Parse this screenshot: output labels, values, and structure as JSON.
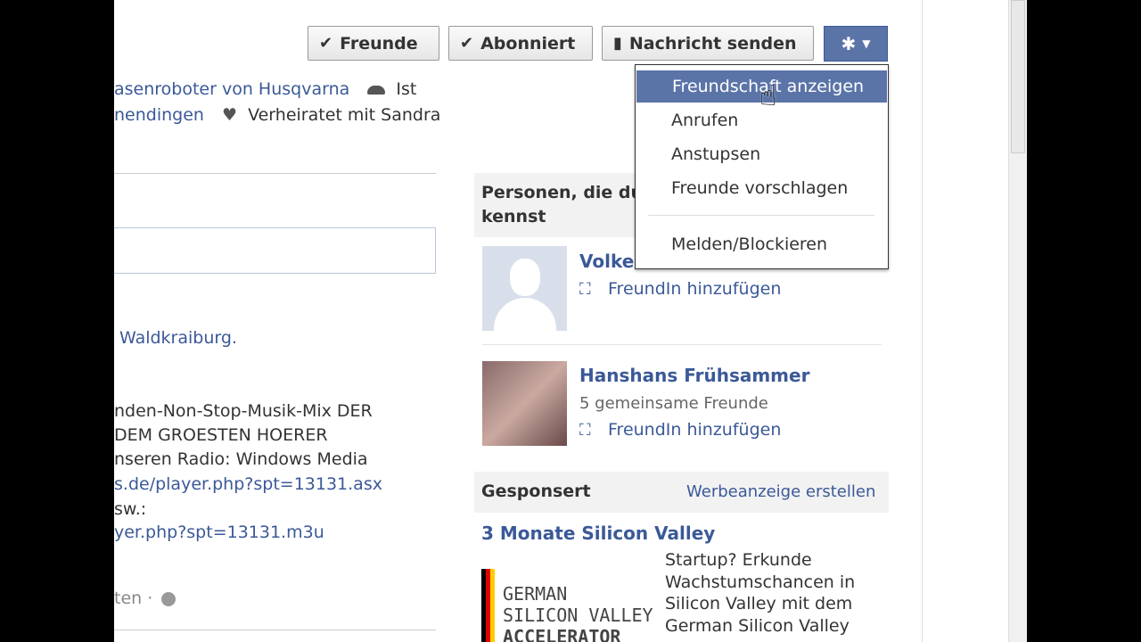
{
  "buttons": {
    "friends": "Freunde",
    "subscribed": "Abonniert",
    "message": "Nachricht senden"
  },
  "menu": {
    "items": [
      "Freundschaft anzeigen",
      "Anrufen",
      "Anstupsen",
      "Freunde vorschlagen"
    ],
    "report": "Melden/Blockieren"
  },
  "profile": {
    "line1_link": "asenroboter von Husqvarna",
    "line1_after": "Ist",
    "line2_link": "nendingen",
    "line2_after": "Verheiratet mit Sandra"
  },
  "left": {
    "location": "Waldkraiburg.",
    "about": [
      "nden-Non-Stop-Musik-Mix DER",
      "DEM GROESTEN HOERER",
      "nseren Radio: Windows Media"
    ],
    "link1": "s.de/player.php?spt=13131.asx",
    "sw": "sw.:",
    "link2": "yer.php?spt=13131.m3u",
    "footer": "ten ·"
  },
  "people": {
    "header": "Personen, die du kennst",
    "p1_name": "Volke",
    "p2_name": "Hanshans Frühsammer",
    "p2_mutual": "5 gemeinsame Freunde",
    "add_friend": "FreundIn hinzufügen"
  },
  "sponsored": {
    "header": "Gesponsert",
    "create": "Werbeanzeige erstellen",
    "ad_title": "3 Monate Silicon Valley",
    "ad_text": "Startup? Erkunde Wachstumschancen in Silicon Valley mit dem German Silicon Valley",
    "logo_text": [
      "GERMAN",
      "SILICON VALLEY",
      "ACCELERATOR"
    ]
  },
  "colors": {
    "link": "#3b5998",
    "menu_highlight": "#5b74a8"
  }
}
